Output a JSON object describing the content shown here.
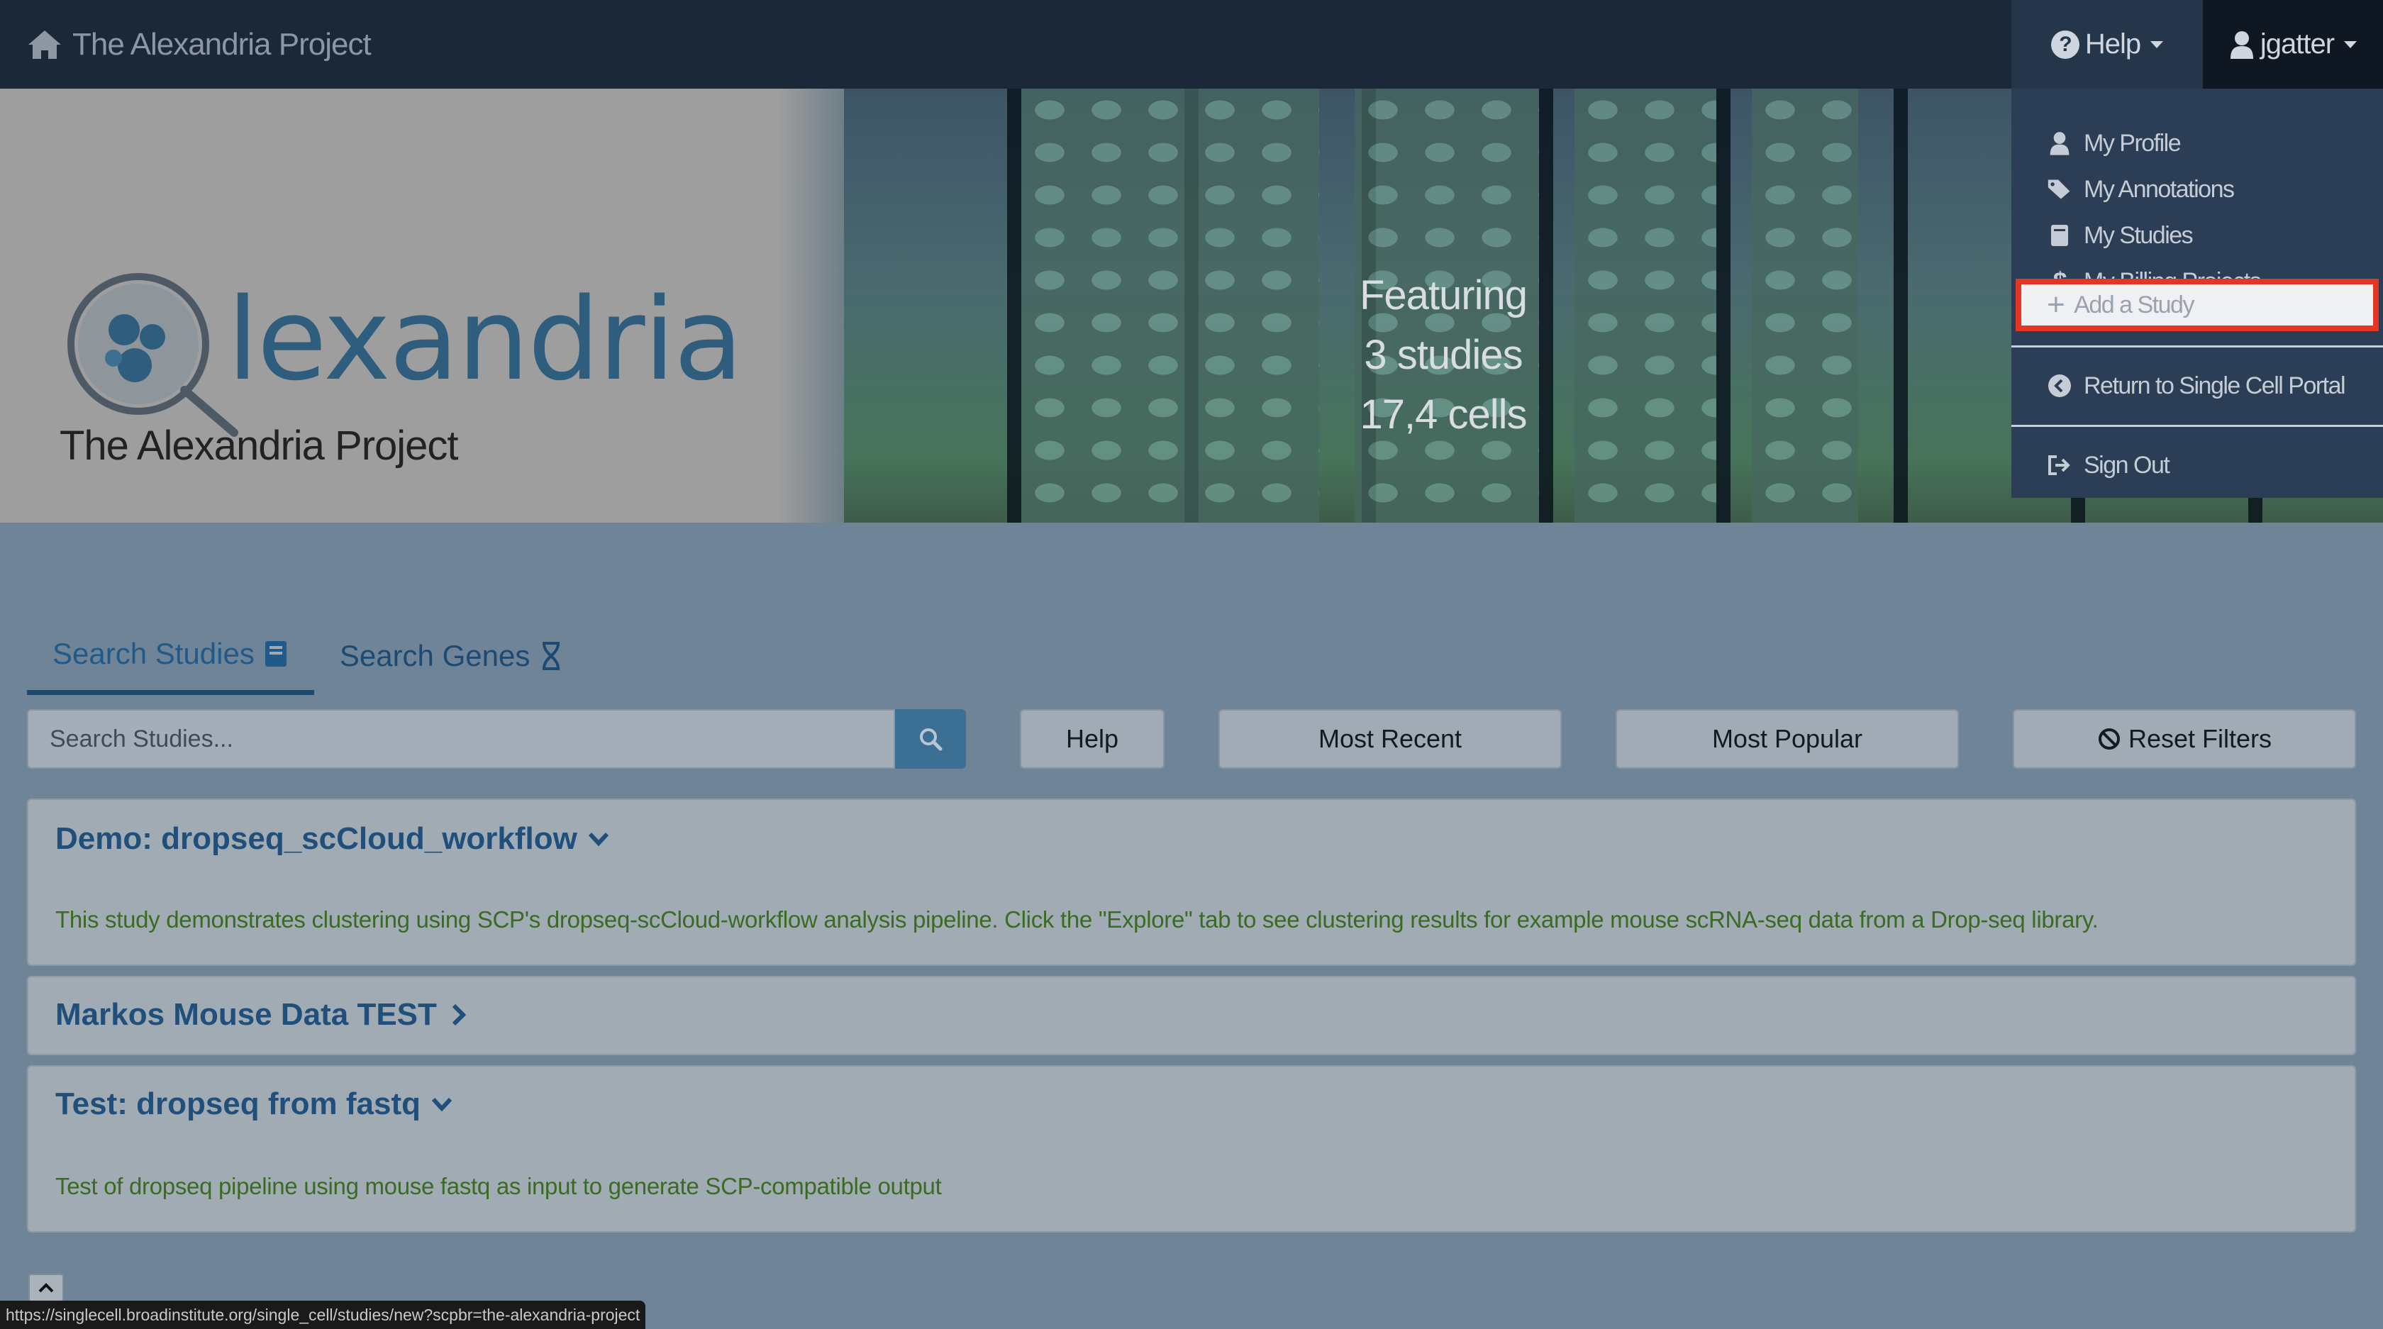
{
  "navbar": {
    "brand": "The Alexandria Project",
    "help_label": "Help",
    "user_label": "jgatter"
  },
  "banner": {
    "logo_text": "lexandria",
    "subtitle": "The Alexandria Project",
    "featuring": {
      "line1": "Featuring",
      "line2": "3 studies",
      "line3": "17,4   cells"
    }
  },
  "dropdown": {
    "items": [
      {
        "label": "My Profile",
        "icon": "user-icon"
      },
      {
        "label": "My Annotations",
        "icon": "tags-icon"
      },
      {
        "label": "My Studies",
        "icon": "book-icon"
      },
      {
        "label": "My Billing Projects",
        "icon": "dollar-icon"
      },
      {
        "label": "Add a Study",
        "icon": "plus-icon"
      },
      {
        "label": "Return to Single Cell Portal",
        "icon": "chevron-left-circle-icon"
      },
      {
        "label": "Sign Out",
        "icon": "sign-out-icon"
      }
    ]
  },
  "tabs": [
    {
      "label": "Search Studies",
      "icon": "book-icon"
    },
    {
      "label": "Search Genes",
      "icon": "dna-icon"
    }
  ],
  "search": {
    "placeholder": "Search Studies..."
  },
  "buttons": {
    "help": "Help",
    "most_recent": "Most Recent",
    "most_popular": "Most Popular",
    "reset_filters": "Reset Filters"
  },
  "studies": [
    {
      "title": "Demo: dropseq_scCloud_workflow",
      "expanded": true,
      "description": "This study demonstrates clustering using SCP's dropseq-scCloud-workflow analysis pipeline.   Click the \"Explore\" tab to see clustering results for example mouse scRNA-seq data from a Drop-seq library."
    },
    {
      "title": "Markos Mouse Data TEST",
      "expanded": false,
      "description": ""
    },
    {
      "title": "Test: dropseq from fastq",
      "expanded": true,
      "description": "Test of dropseq pipeline using mouse fastq as input to generate SCP-compatible output"
    }
  ],
  "status_bar": {
    "url": "https://singlecell.broadinstitute.org/single_cell/studies/new?scpbr=the-alexandria-project"
  },
  "colors": {
    "navbar": "#1b2838",
    "link": "#1f4f7a",
    "description": "#3a6b22",
    "highlight_border": "#e53524"
  }
}
